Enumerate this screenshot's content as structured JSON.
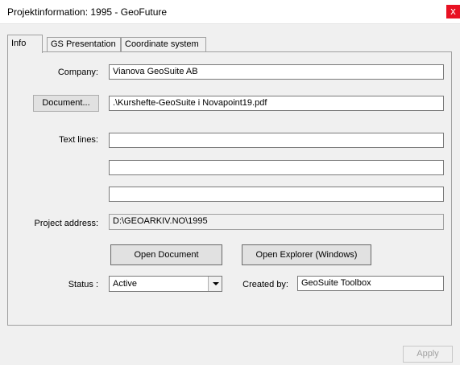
{
  "window": {
    "title": "Projektinformation: 1995 - GeoFuture",
    "close_glyph": "x"
  },
  "tabs": [
    {
      "label": "Info",
      "active": true
    },
    {
      "label": "GS Presentation",
      "active": false
    },
    {
      "label": "Coordinate system",
      "active": false
    }
  ],
  "info": {
    "company_label": "Company:",
    "company_value": "Vianova GeoSuite AB",
    "document_button": "Document...",
    "document_value": ".\\Kurshefte-GeoSuite  i Novapoint19.pdf",
    "text_lines_label": "Text lines:",
    "text_lines": [
      "",
      "",
      ""
    ],
    "project_address_label": "Project address:",
    "project_address_value": "D:\\GEOARKIV.NO\\1995",
    "open_document_button": "Open Document",
    "open_explorer_button": "Open Explorer (Windows)",
    "status_label": "Status :",
    "status_value": "Active",
    "created_by_label": "Created by:",
    "created_by_value": "GeoSuite Toolbox"
  },
  "footer": {
    "apply_button": "Apply",
    "apply_enabled": false
  }
}
